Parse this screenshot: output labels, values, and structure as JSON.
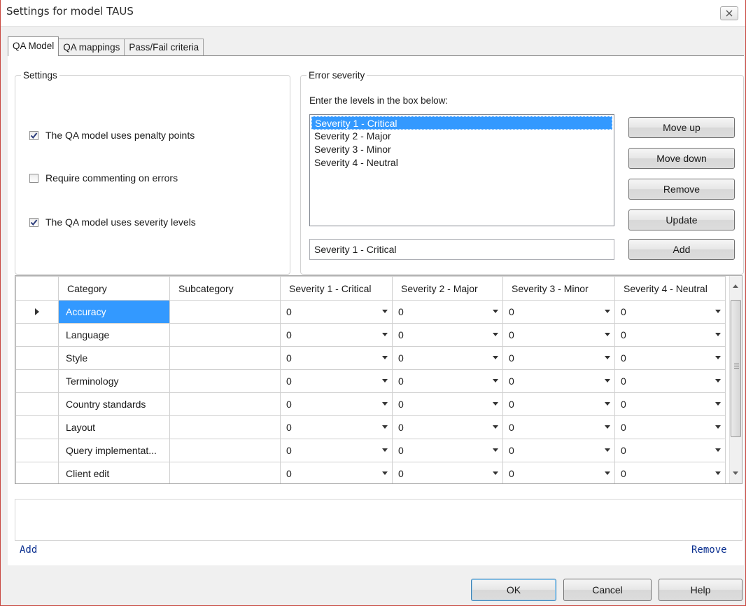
{
  "window": {
    "title": "Settings for model TAUS"
  },
  "tabs": [
    {
      "label": "QA Model",
      "active": true
    },
    {
      "label": "QA mappings",
      "active": false
    },
    {
      "label": "Pass/Fail criteria",
      "active": false
    }
  ],
  "settings": {
    "legend": "Settings",
    "options": [
      {
        "label": "The QA model uses penalty points",
        "checked": true
      },
      {
        "label": "Require commenting on errors",
        "checked": false
      },
      {
        "label": "The QA model uses severity levels",
        "checked": true
      }
    ]
  },
  "severity": {
    "legend": "Error severity",
    "hint": "Enter the levels in the box below:",
    "levels": [
      "Severity 1 - Critical",
      "Severity 2 - Major",
      "Severity 3 - Minor",
      "Severity 4 - Neutral"
    ],
    "selected_index": 0,
    "input_value": "Severity 1 - Critical",
    "buttons": {
      "move_up": "Move up",
      "move_down": "Move down",
      "remove": "Remove",
      "update": "Update",
      "add": "Add"
    }
  },
  "grid": {
    "columns": [
      "Category",
      "Subcategory",
      "Severity 1 - Critical",
      "Severity 2 - Major",
      "Severity 3 - Minor",
      "Severity 4 - Neutral"
    ],
    "rows": [
      {
        "category": "Accuracy",
        "subcategory": "",
        "values": [
          "0",
          "0",
          "0",
          "0"
        ],
        "selected": true
      },
      {
        "category": "Language",
        "subcategory": "",
        "values": [
          "0",
          "0",
          "0",
          "0"
        ]
      },
      {
        "category": "Style",
        "subcategory": "",
        "values": [
          "0",
          "0",
          "0",
          "0"
        ]
      },
      {
        "category": "Terminology",
        "subcategory": "",
        "values": [
          "0",
          "0",
          "0",
          "0"
        ]
      },
      {
        "category": "Country standards",
        "subcategory": "",
        "values": [
          "0",
          "0",
          "0",
          "0"
        ]
      },
      {
        "category": "Layout",
        "subcategory": "",
        "values": [
          "0",
          "0",
          "0",
          "0"
        ]
      },
      {
        "category": "Query implementat...",
        "subcategory": "",
        "values": [
          "0",
          "0",
          "0",
          "0"
        ]
      },
      {
        "category": "Client edit",
        "subcategory": "",
        "values": [
          "0",
          "0",
          "0",
          "0"
        ]
      }
    ]
  },
  "links": {
    "add": "Add",
    "remove": "Remove"
  },
  "footer": {
    "ok": "OK",
    "cancel": "Cancel",
    "help": "Help"
  },
  "colors": {
    "selection": "#3399ff",
    "window_border": "#c8473f",
    "link": "#0a2f8f"
  }
}
